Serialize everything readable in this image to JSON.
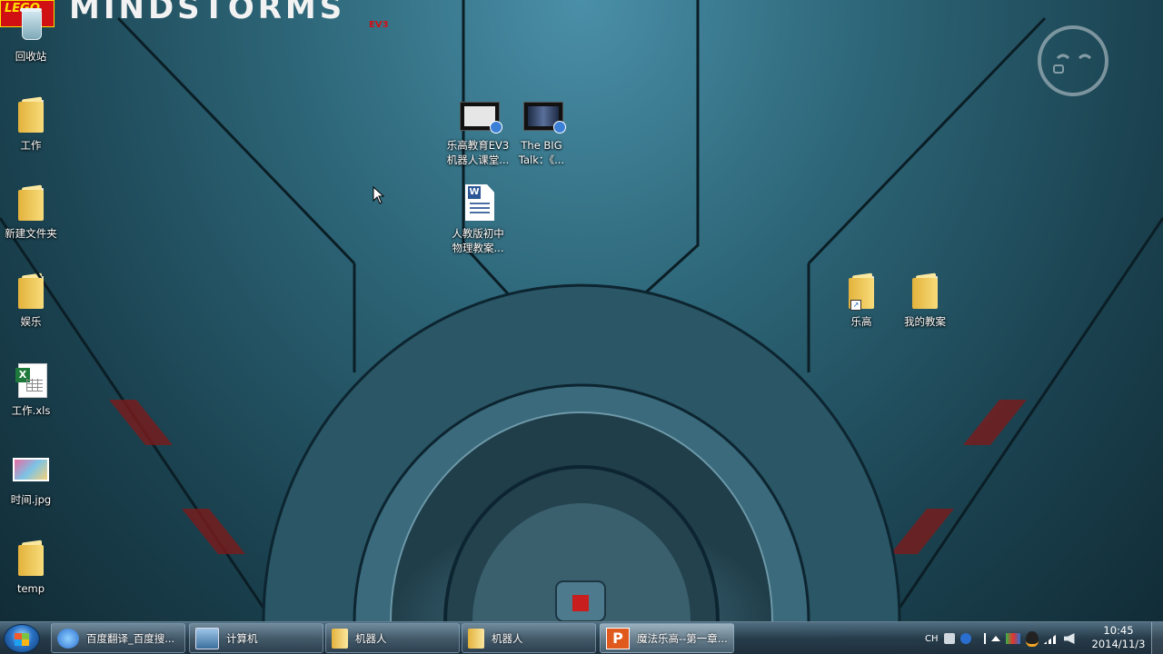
{
  "wallpaper": {
    "brand_logo": "LEGO",
    "brand_text": "MINDSTORMS",
    "brand_sub": "EV3"
  },
  "desktop_left": [
    {
      "label": "回收站",
      "icon": "recycle-bin-icon"
    },
    {
      "label": "工作",
      "icon": "folder-icon"
    },
    {
      "label": "新建文件夹",
      "icon": "folder-icon"
    },
    {
      "label": "娱乐",
      "icon": "folder-icon"
    },
    {
      "label": "工作.xls",
      "icon": "excel-file-icon"
    },
    {
      "label": "时间.jpg",
      "icon": "image-file-icon"
    },
    {
      "label": "temp",
      "icon": "folder-icon"
    }
  ],
  "desktop_center": [
    {
      "label_line1": "乐高教育EV3",
      "label_line2": "机器人课堂...",
      "icon": "video-file-icon"
    },
    {
      "label_line1": "The BIG",
      "label_line2": "Talk：《...",
      "icon": "video-file-icon"
    },
    {
      "label_line1": "人教版初中",
      "label_line2": "物理教案...",
      "icon": "word-document-icon"
    }
  ],
  "desktop_right": [
    {
      "label": "乐高",
      "icon": "folder-shortcut-icon"
    },
    {
      "label": "我的教案",
      "icon": "folder-icon"
    }
  ],
  "taskbar": {
    "tasks": [
      {
        "label": "百度翻译_百度搜...",
        "icon": "ie-browser-icon"
      },
      {
        "label": "计算机",
        "icon": "computer-icon"
      },
      {
        "label": "机器人",
        "icon": "folder-icon"
      },
      {
        "label": "机器人",
        "icon": "folder-icon"
      },
      {
        "label": "魔法乐高--第一章...",
        "icon": "powerpoint-icon"
      }
    ],
    "tray": {
      "input_method": "CH",
      "time": "10:45",
      "date": "2014/11/3"
    }
  }
}
